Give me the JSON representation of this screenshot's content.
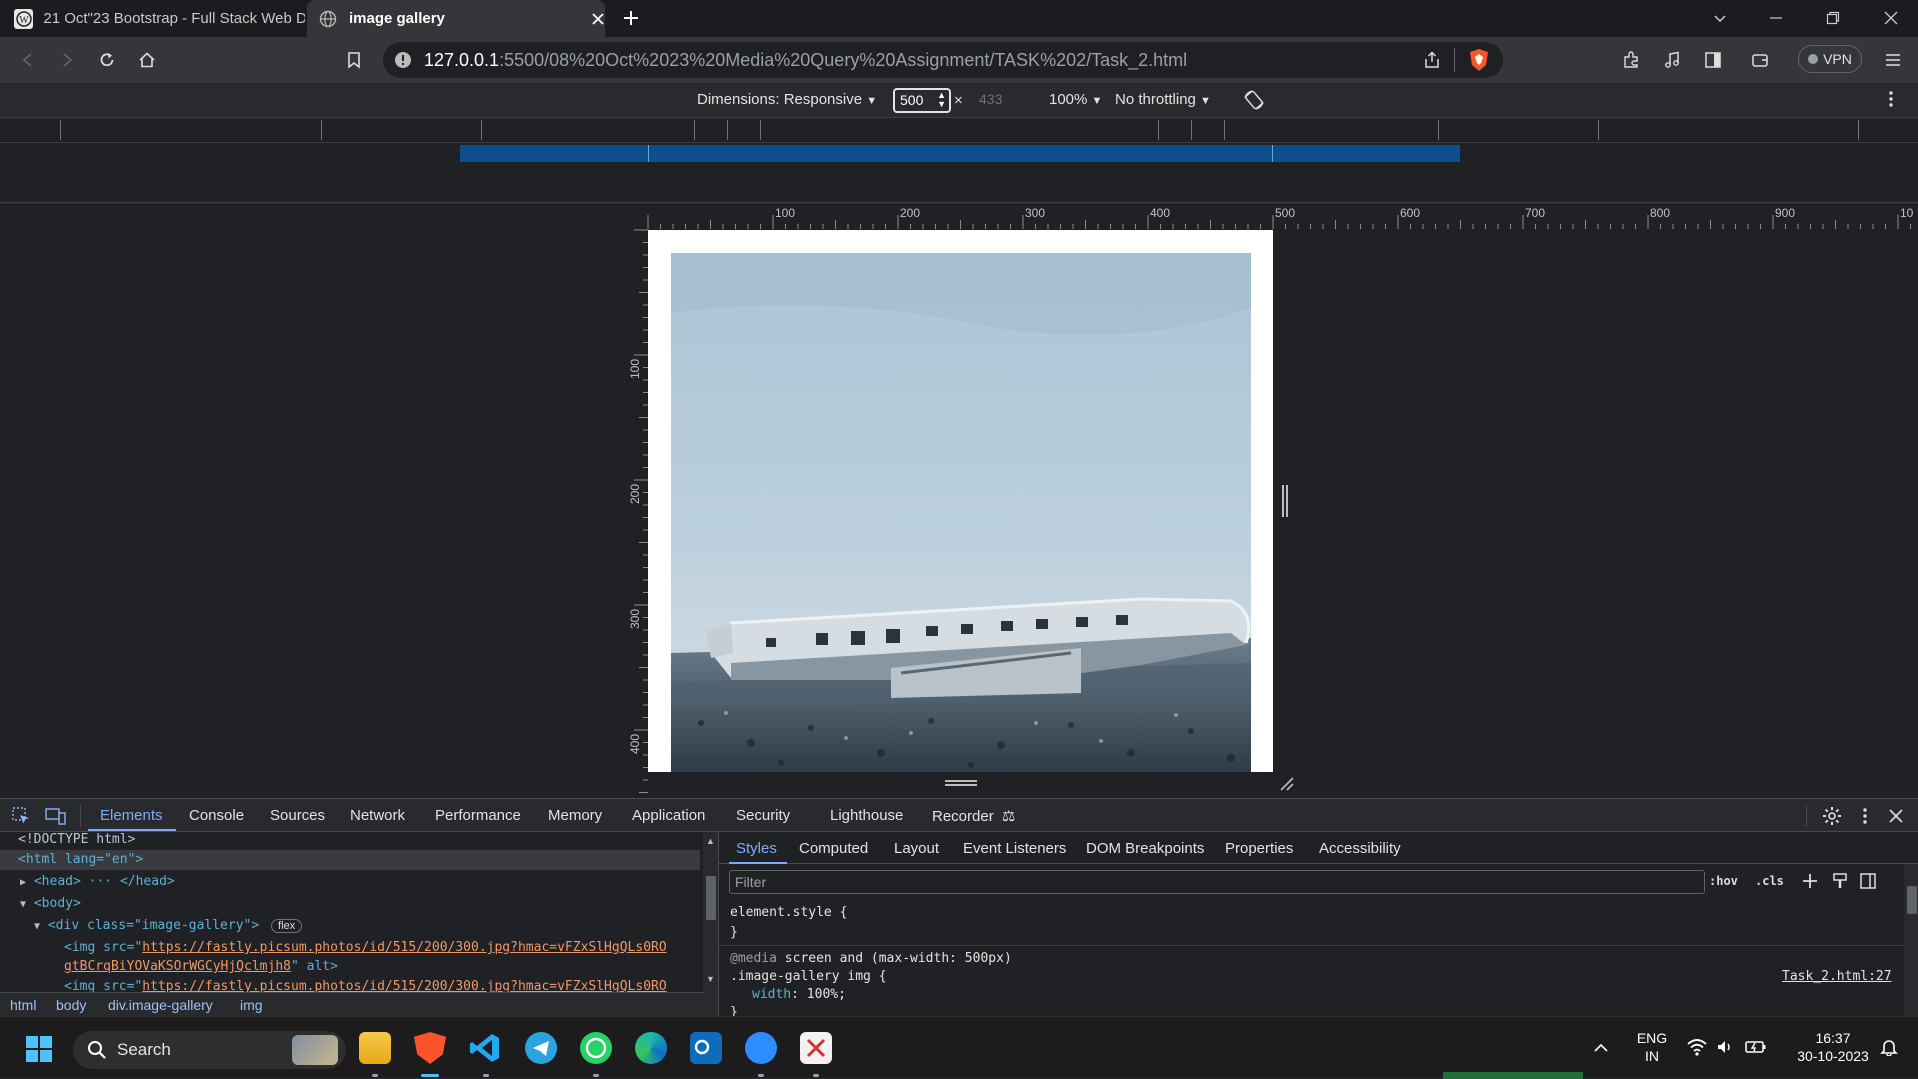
{
  "browser": {
    "tabs": [
      {
        "title": "21 Oct\"23 Bootstrap - Full Stack Web D",
        "active": false
      },
      {
        "title": "image gallery",
        "active": true
      }
    ],
    "url_host": "127.0.0.1",
    "url_path": ":5500/08%20Oct%2023%20Media%20Query%20Assignment/TASK%202/Task_2.html",
    "vpn_label": "VPN"
  },
  "device_toolbar": {
    "dimensions_label": "Dimensions: Responsive",
    "width_value": "500",
    "times": "×",
    "height_value": "433",
    "zoom": "100%",
    "throttling": "No throttling"
  },
  "rulers": {
    "top_ticks": [
      "100",
      "200",
      "300",
      "400",
      "500",
      "600",
      "700",
      "800",
      "900",
      "10"
    ],
    "left_ticks": [
      "100",
      "200",
      "300",
      "400"
    ]
  },
  "devtools": {
    "tabs": [
      "Elements",
      "Console",
      "Sources",
      "Network",
      "Performance",
      "Memory",
      "Application",
      "Security",
      "Lighthouse",
      "Recorder"
    ],
    "active_tab": "Elements",
    "dom": {
      "doctype": "<!DOCTYPE html>",
      "html_open": "<html lang=\"en\">",
      "head": "<head> ··· </head>",
      "body_open": "<body>",
      "div_open_tag": "<div class=\"image-gallery\">",
      "flex_badge": "flex",
      "img_prefix": "<img src=\"",
      "img_link1": "https://fastly.picsum.photos/id/515/200/300.jpg?hmac=vFZxSlHgQLs0RO",
      "img_link1_cont": "gtBCrqBiYOVaKSOrWGCyHjQclmjh8",
      "img_suffix": "\" alt>",
      "img_link2": "https://fastly.picsum.photos/id/515/200/300.jpg?hmac=vFZxSlHgQLs0RO"
    },
    "breadcrumbs": [
      "html",
      "body",
      "div.image-gallery",
      "img"
    ],
    "styles_tabs": [
      "Styles",
      "Computed",
      "Layout",
      "Event Listeners",
      "DOM Breakpoints",
      "Properties",
      "Accessibility"
    ],
    "filter_placeholder": "Filter",
    "hov": ":hov",
    "cls": ".cls",
    "css": {
      "element_style": "element.style {",
      "close_brace": "}",
      "media_at": "@media",
      "media_query": "screen and (max-width: 500px)",
      "selector": ".image-gallery img {",
      "prop_name": "width",
      "prop_value": "100%;",
      "source_link": "Task_2.html:27"
    }
  },
  "taskbar": {
    "search_label": "Search",
    "lang_line1": "ENG",
    "lang_line2": "IN",
    "time": "16:37",
    "date": "30-10-2023"
  }
}
